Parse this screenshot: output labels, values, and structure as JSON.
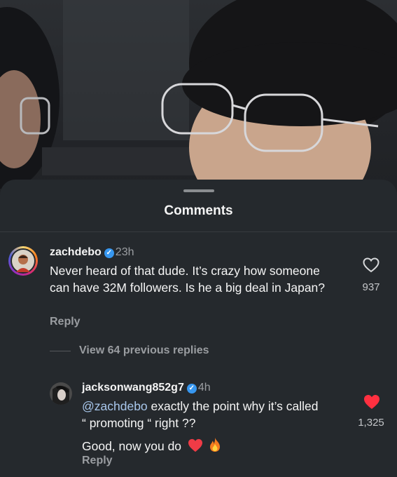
{
  "sheet": {
    "title": "Comments"
  },
  "comments": [
    {
      "username": "zachdebo",
      "time": "23h",
      "text": "Never heard of that dude. It’s crazy how someone can have 32M followers. Is he a big deal in Japan?",
      "reply_label": "Reply",
      "like_count": "937",
      "liked": false
    }
  ],
  "replies_toggle": "View 64 previous replies",
  "replies": [
    {
      "username": "jacksonwang852g7",
      "time": "4h",
      "mention": "@zachdebo",
      "text_line1": " exactly the point why it’s called",
      "text_line2": "“ promoting “ right ??",
      "text_line3": "Good, now you do",
      "emojis": [
        "heart-emoji",
        "fire-emoji"
      ],
      "reply_label": "Reply",
      "like_count": "1,325",
      "liked": true
    }
  ],
  "colors": {
    "sheet": "#25292d",
    "liked_heart": "#ff3040",
    "verified": "#3797f0",
    "mention": "#a8c7ec"
  }
}
